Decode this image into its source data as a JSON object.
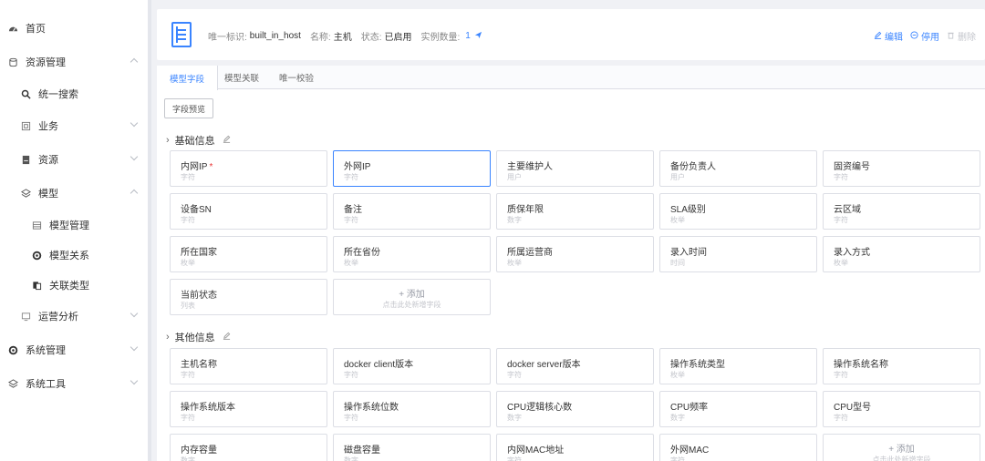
{
  "sidebar": {
    "items": [
      {
        "label": "首页",
        "icon": "dashboard-icon"
      },
      {
        "label": "资源管理",
        "icon": "database-icon"
      },
      {
        "label": "统一搜索",
        "icon": "search-icon"
      },
      {
        "label": "业务",
        "icon": "business-icon"
      },
      {
        "label": "资源",
        "icon": "resource-icon"
      },
      {
        "label": "模型",
        "icon": "model-icon"
      },
      {
        "label": "模型管理",
        "icon": "list-icon"
      },
      {
        "label": "模型关系",
        "icon": "relation-icon"
      },
      {
        "label": "关联类型",
        "icon": "link-type-icon"
      },
      {
        "label": "运营分析",
        "icon": "analytics-icon"
      },
      {
        "label": "系统管理",
        "icon": "settings-icon"
      },
      {
        "label": "系统工具",
        "icon": "tools-icon"
      }
    ]
  },
  "header": {
    "id_label": "唯一标识:",
    "id_value": "built_in_host",
    "name_label": "名称:",
    "name_value": "主机",
    "status_label": "状态:",
    "status_value": "已启用",
    "count_label": "实例数量:",
    "count_value": "1",
    "edit": "编辑",
    "disable": "停用",
    "delete": "删除"
  },
  "tabs": [
    {
      "label": "模型字段",
      "active": true
    },
    {
      "label": "模型关联",
      "active": false
    },
    {
      "label": "唯一校验",
      "active": false
    }
  ],
  "preview_button": "字段预览",
  "groups": [
    {
      "title": "基础信息",
      "fields": [
        {
          "name": "内网IP",
          "type": "字符",
          "required": true
        },
        {
          "name": "外网IP",
          "type": "字符",
          "selected": true
        },
        {
          "name": "主要维护人",
          "type": "用户"
        },
        {
          "name": "备份负责人",
          "type": "用户"
        },
        {
          "name": "固资编号",
          "type": "字符"
        },
        {
          "name": "设备SN",
          "type": "字符"
        },
        {
          "name": "备注",
          "type": "字符"
        },
        {
          "name": "质保年限",
          "type": "数字"
        },
        {
          "name": "SLA级别",
          "type": "枚举"
        },
        {
          "name": "云区域",
          "type": "字符"
        },
        {
          "name": "所在国家",
          "type": "枚举"
        },
        {
          "name": "所在省份",
          "type": "枚举"
        },
        {
          "name": "所属运营商",
          "type": "枚举"
        },
        {
          "name": "录入时间",
          "type": "时间"
        },
        {
          "name": "录入方式",
          "type": "枚举"
        },
        {
          "name": "当前状态",
          "type": "列表"
        }
      ]
    },
    {
      "title": "其他信息",
      "fields": [
        {
          "name": "主机名称",
          "type": "字符"
        },
        {
          "name": "docker client版本",
          "type": "字符"
        },
        {
          "name": "docker server版本",
          "type": "字符"
        },
        {
          "name": "操作系统类型",
          "type": "枚举"
        },
        {
          "name": "操作系统名称",
          "type": "字符"
        },
        {
          "name": "操作系统版本",
          "type": "字符"
        },
        {
          "name": "操作系统位数",
          "type": "字符"
        },
        {
          "name": "CPU逻辑核心数",
          "type": "数字"
        },
        {
          "name": "CPU频率",
          "type": "数字"
        },
        {
          "name": "CPU型号",
          "type": "字符"
        },
        {
          "name": "内存容量",
          "type": "数字"
        },
        {
          "name": "磁盘容量",
          "type": "数字"
        },
        {
          "name": "内网MAC地址",
          "type": "字符"
        },
        {
          "name": "外网MAC",
          "type": "字符"
        }
      ]
    }
  ],
  "add_card": {
    "label": "+ 添加",
    "hint": "点击此处新增字段"
  },
  "colors": {
    "accent": "#3a84ff",
    "required": "#ea3636",
    "muted": "#c4c6cc"
  }
}
